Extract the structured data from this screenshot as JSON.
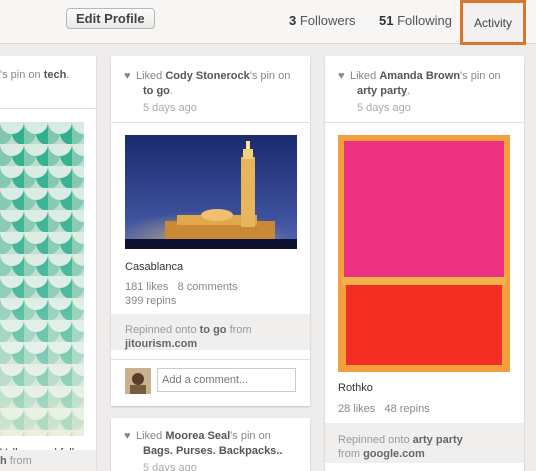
{
  "header": {
    "edit_profile": "Edit Profile",
    "followers_count": "3",
    "followers_label": "Followers",
    "following_count": "51",
    "following_label": "Following",
    "activity": "Activity"
  },
  "col1": {
    "top_text": "'s pin on",
    "top_board": "tech",
    "bottom_text": "Vallpapers | fellow",
    "footer_prefix": "h",
    "footer_from": "from"
  },
  "col2": {
    "activity_1": {
      "verb": "Liked",
      "user": "Cody Stonerock",
      "mid": "'s pin on",
      "board": "to go",
      "time": "5 days ago"
    },
    "pin": {
      "description": "Casablanca",
      "likes": "181 likes",
      "comments": "8 comments",
      "repins": "399 repins",
      "repinned_label": "Repinned onto",
      "board": "to go",
      "from_label": "from",
      "source": "jitourism.com",
      "comment_placeholder": "Add a comment..."
    },
    "activity_2": {
      "verb": "Liked",
      "user": "Moorea Seal",
      "mid": "'s pin on",
      "board": "Bags. Purses. Backpacks..",
      "time": "5 days ago"
    }
  },
  "col3": {
    "activity_1": {
      "verb": "Liked",
      "user": "Amanda Brown",
      "mid": "'s pin on",
      "board": "arty party",
      "time": "5 days ago"
    },
    "pin": {
      "description": "Rothko",
      "likes": "28 likes",
      "repins": "48 repins",
      "repinned_label": "Repinned onto",
      "board": "arty party",
      "from_label": "from",
      "source": "google.com"
    }
  },
  "icons": {
    "heart": "heart-icon"
  },
  "colors": {
    "activity_highlight": "#d9752e",
    "rothko_pink": "#f0357a",
    "rothko_red": "#f22e22"
  }
}
